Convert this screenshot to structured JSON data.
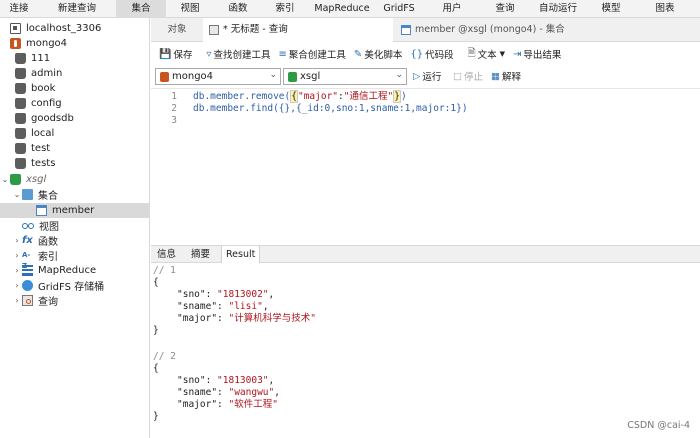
{
  "menu": [
    "连接",
    "新建查询",
    "集合",
    "视图",
    "函数",
    "索引",
    "MapReduce",
    "GridFS",
    "用户",
    "查询",
    "自动运行",
    "模型",
    "图表"
  ],
  "tree": {
    "connection": "localhost_3306",
    "server": "mongo4",
    "databases": [
      "111",
      "admin",
      "book",
      "config",
      "goodsdb",
      "local",
      "test",
      "tests"
    ],
    "open_db": "xsgl",
    "collections_folder": "集合",
    "selected_collection": "member",
    "views": "视图",
    "functions": "函数",
    "indexes": "索引",
    "mapreduce": "MapReduce",
    "gridfs": "GridFS 存储桶",
    "queries": "查询"
  },
  "tabs": {
    "objects": "对象",
    "query_tab": "* 无标题 - 查询",
    "collection_tab": "member @xsgl (mongo4) - 集合"
  },
  "toolbar": {
    "save": "保存",
    "find_builder": "查找创建工具",
    "agg_builder": "聚合创建工具",
    "beautify": "美化脚本",
    "snippet": "代码段",
    "text": "文本",
    "export": "导出结果"
  },
  "selectors": {
    "server": "mongo4",
    "database": "xsgl",
    "run": "运行",
    "stop": "停止",
    "explain": "解释"
  },
  "editor": {
    "line_numbers": [
      "1",
      "2",
      "3"
    ],
    "line1": {
      "prefix": "db.member.remove(",
      "open": "{",
      "key": "\"major\"",
      "colon": ":",
      "value": "\"通信工程\"",
      "close": "}",
      "suffix": ")"
    },
    "line2": "db.member.find({},{_id:0,sno:1,sname:1,major:1})"
  },
  "result_tabs": [
    "信息",
    "摘要",
    "Result"
  ],
  "results": [
    {
      "comment": "// 1",
      "sno": "\"1813002\"",
      "sname": "\"lisi\"",
      "major": "\"计算机科学与技术\""
    },
    {
      "comment": "// 2",
      "sno": "\"1813003\"",
      "sname": "\"wangwu\"",
      "major": "\"软件工程\""
    }
  ],
  "result_keys": {
    "sno": "\"sno\": ",
    "sname": "\"sname\": ",
    "major": "\"major\": "
  },
  "braces": {
    "open": "{",
    "close": "}",
    "comma": ","
  },
  "watermark": "CSDN @cai-4"
}
